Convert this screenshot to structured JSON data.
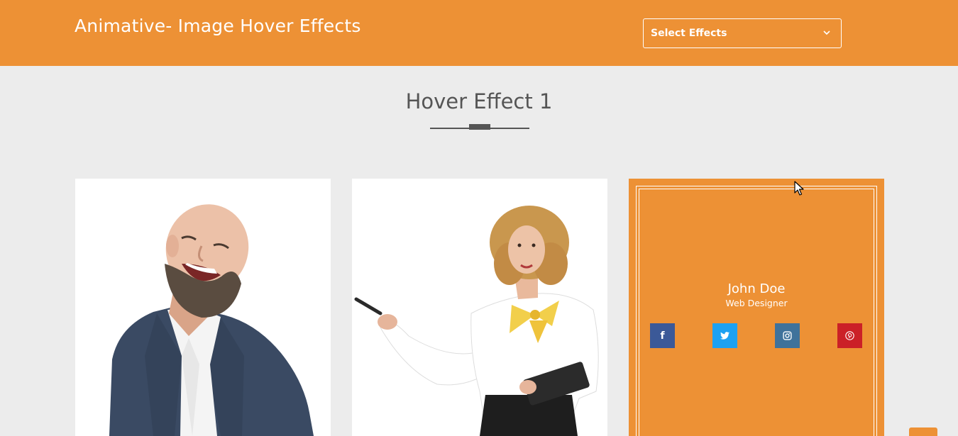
{
  "header": {
    "title": "Animative- Image Hover Effects",
    "select_label": "Select Effects",
    "select_icon": "chevron-down-icon"
  },
  "section": {
    "title": "Hover Effect 1"
  },
  "cards": [
    {
      "image": "bald-bearded-man-laughing-photo"
    },
    {
      "image": "blonde-woman-pointing-with-pen-photo"
    },
    {
      "name": "John Doe",
      "role": "Web Designer",
      "social": [
        {
          "icon": "facebook-icon",
          "glyph": "f",
          "color": "#3b5998"
        },
        {
          "icon": "twitter-icon",
          "glyph": "t",
          "color": "#1da1f2"
        },
        {
          "icon": "instagram-icon",
          "glyph": "◎",
          "color": "#3f729b"
        },
        {
          "icon": "pinterest-icon",
          "glyph": "p",
          "color": "#cb2027"
        }
      ]
    }
  ],
  "colors": {
    "accent": "#ed9135",
    "background": "#ececec",
    "heading": "#555555"
  }
}
